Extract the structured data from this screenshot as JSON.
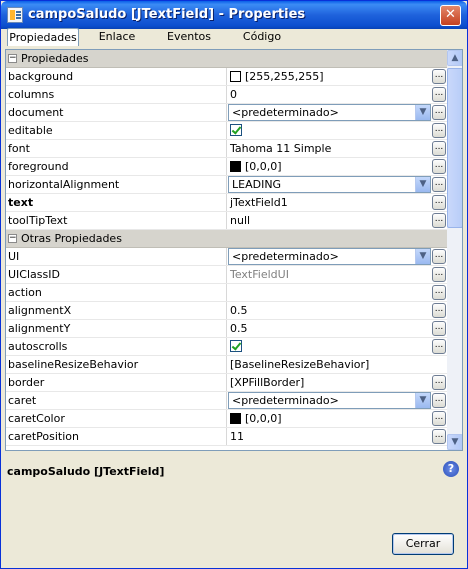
{
  "window": {
    "title": "campoSaludo [JTextField] - Properties",
    "close_glyph": "✕"
  },
  "tabs": [
    {
      "label": "Propiedades",
      "active": true
    },
    {
      "label": "Enlace",
      "active": false
    },
    {
      "label": "Eventos",
      "active": false
    },
    {
      "label": "Código",
      "active": false
    }
  ],
  "categories": {
    "properties": "Propiedades",
    "other": "Otras Propiedades"
  },
  "properties": [
    {
      "name": "background",
      "value": "[255,255,255]",
      "kind": "color",
      "color": "#ffffff"
    },
    {
      "name": "columns",
      "value": "0",
      "kind": "text"
    },
    {
      "name": "document",
      "value": "<predeterminado>",
      "kind": "combo"
    },
    {
      "name": "editable",
      "value": "true",
      "kind": "check"
    },
    {
      "name": "font",
      "value": "Tahoma 11 Simple",
      "kind": "text"
    },
    {
      "name": "foreground",
      "value": "[0,0,0]",
      "kind": "color",
      "color": "#000000"
    },
    {
      "name": "horizontalAlignment",
      "value": "LEADING",
      "kind": "combo"
    },
    {
      "name": "text",
      "value": "jTextField1",
      "kind": "text",
      "bold": true
    },
    {
      "name": "toolTipText",
      "value": "null",
      "kind": "text"
    }
  ],
  "other_properties": [
    {
      "name": "UI",
      "value": "<predeterminado>",
      "kind": "combo"
    },
    {
      "name": "UIClassID",
      "value": "TextFieldUI",
      "kind": "text",
      "muted": true
    },
    {
      "name": "action",
      "value": "",
      "kind": "text"
    },
    {
      "name": "alignmentX",
      "value": "0.5",
      "kind": "text"
    },
    {
      "name": "alignmentY",
      "value": "0.5",
      "kind": "text"
    },
    {
      "name": "autoscrolls",
      "value": "true",
      "kind": "check"
    },
    {
      "name": "baselineResizeBehavior",
      "value": "[BaselineResizeBehavior]",
      "kind": "text",
      "no_dots": true
    },
    {
      "name": "border",
      "value": "[XPFillBorder]",
      "kind": "text"
    },
    {
      "name": "caret",
      "value": "<predeterminado>",
      "kind": "combo"
    },
    {
      "name": "caretColor",
      "value": "[0,0,0]",
      "kind": "color",
      "color": "#000000"
    },
    {
      "name": "caretPosition",
      "value": "11",
      "kind": "text"
    }
  ],
  "description": {
    "title": "campoSaludo [JTextField]",
    "help_glyph": "?"
  },
  "buttons": {
    "close_label": "Cerrar",
    "dots_label": "...",
    "minus_glyph": "−",
    "combo_arrow": "▼",
    "scroll_up": "▲",
    "scroll_down": "▼"
  }
}
